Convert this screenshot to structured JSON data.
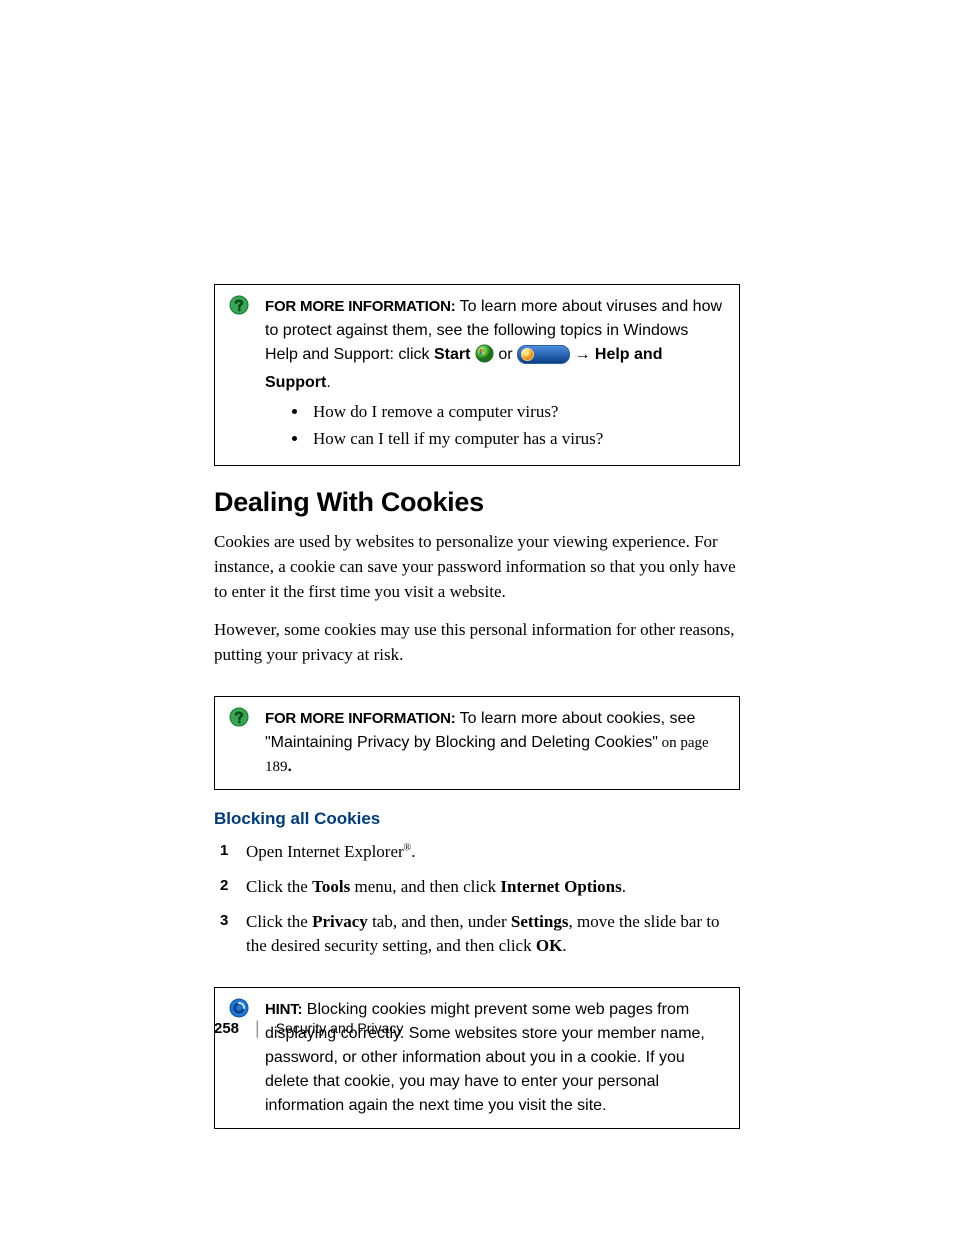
{
  "callout1": {
    "lead": "FOR MORE INFORMATION:",
    "line1_part1": " To learn more about viruses and how to protect against them, see the following topics in Windows Help and Support: click ",
    "start": "Start",
    "or": "  or  ",
    "arrow": " → ",
    "help_support": "Help and Support",
    "period": ".",
    "bullet1": "How do I remove a computer virus?",
    "bullet2": "How can I tell if my computer has a virus?"
  },
  "section_title": "Dealing With Cookies",
  "para1": "Cookies are used by websites to personalize your viewing experience. For instance, a cookie can save your password information so that you only have to enter it the first time you visit a website.",
  "para2": "However, some cookies may use this personal information for other reasons, putting your privacy at risk.",
  "callout2": {
    "lead": "FOR MORE INFORMATION:",
    "text1": " To learn more about cookies, see \"Maintaining Privacy by Blocking and Deleting Cookies\"",
    "pageref": " on page 189",
    "period": "."
  },
  "subhead": "Blocking all Cookies",
  "steps": {
    "n1": "1",
    "s1_a": "Open Internet Explorer",
    "s1_reg": "®",
    "s1_b": ".",
    "n2": "2",
    "s2_a": "Click the ",
    "s2_tools": "Tools",
    "s2_b": " menu, and then click ",
    "s2_io": "Internet Options",
    "s2_c": ".",
    "n3": "3",
    "s3_a": "Click the ",
    "s3_priv": "Privacy",
    "s3_b": " tab, and then, under ",
    "s3_settings": "Settings",
    "s3_c": ", move the slide bar to the desired security setting, and then click ",
    "s3_ok": "OK",
    "s3_d": "."
  },
  "hint": {
    "lead": "HINT:",
    "text": " Blocking cookies might prevent some web pages from displaying correctly. Some websites store your member name, password, or other information about you in a cookie. If you delete that cookie, you may have to enter your personal information again the next time you visit the site."
  },
  "footer": {
    "page": "258",
    "section": "Security and Privacy"
  }
}
